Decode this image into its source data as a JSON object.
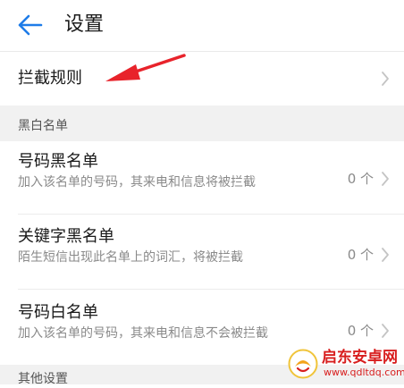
{
  "header": {
    "title": "设置"
  },
  "rules_row": {
    "label": "拦截规则"
  },
  "section": {
    "title": "黑白名单"
  },
  "items": [
    {
      "name": "号码黑名单",
      "desc": "加入该名单的号码，其来电和信息将被拦截",
      "count": "0 个"
    },
    {
      "name": "关键字黑名单",
      "desc": "陌生短信出现此名单上的词汇，将被拦截",
      "count": "0 个"
    },
    {
      "name": "号码白名单",
      "desc": "加入该名单的号码，其来电和信息不会被拦截",
      "count": "0 个"
    }
  ],
  "bottom_section": {
    "title": "其他设置"
  },
  "watermark": {
    "name": "启东安卓网",
    "url": "www.qdltdq.com"
  },
  "colors": {
    "accent": "#1e7ce8",
    "annotation_arrow": "#e8232b",
    "section_bg": "#f1f1f1",
    "watermark": "#d81e1e"
  },
  "icons": {
    "back": "arrow-left-icon",
    "chevron": "chevron-right-icon"
  }
}
